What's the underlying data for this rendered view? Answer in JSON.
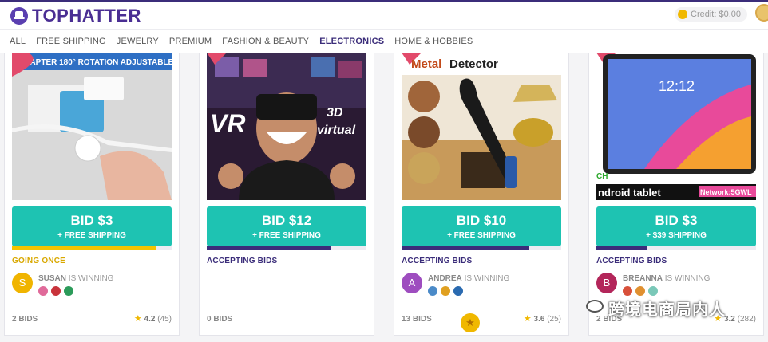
{
  "header": {
    "logo_text": "TOPHATTER",
    "credit": "Credit: $0.00"
  },
  "nav": [
    "ALL",
    "FREE SHIPPING",
    "JEWELRY",
    "PREMIUM",
    "FASHION & BEAUTY",
    "ELECTRONICS",
    "HOME & HOBBIES"
  ],
  "nav_active": "ELECTRONICS",
  "cards": [
    {
      "image_text": "ADAPTER 180° ROTATION ADJUSTABLE",
      "bid": "BID $3",
      "shipping": "+ FREE SHIPPING",
      "progress": 0.9,
      "progress_color": "#f4c400",
      "status": "GOING ONCE",
      "status_color": "#d9a800",
      "winner_initial": "S",
      "winner_name": "SUSAN",
      "winner_suffix": "IS WINNING",
      "avatar_color": "#f0b400",
      "bids": "2 BIDS",
      "rating": "4.2",
      "reviews": "(45)"
    },
    {
      "image_text": "VR 3D virtual",
      "bid": "BID $12",
      "shipping": "+ FREE SHIPPING",
      "progress": 0.78,
      "progress_color": "#3b2d7a",
      "status": "ACCEPTING BIDS",
      "status_color": "#3b2d7a",
      "winner_initial": "",
      "winner_name": "",
      "winner_suffix": "",
      "avatar_color": "",
      "bids": "0 BIDS",
      "rating": "",
      "reviews": ""
    },
    {
      "image_text": "Metal Detector",
      "bid": "BID $10",
      "shipping": "+ FREE SHIPPING",
      "progress": 0.8,
      "progress_color": "#3b2d7a",
      "status": "ACCEPTING BIDS",
      "status_color": "#3b2d7a",
      "winner_initial": "A",
      "winner_name": "ANDREA",
      "winner_suffix": "IS WINNING",
      "avatar_color": "#9e4dbf",
      "bids": "13 BIDS",
      "rating": "3.6",
      "reviews": "(25)"
    },
    {
      "image_text": "ndroid tablet",
      "image_badge": "Network:5GWL",
      "image_time": "12:12",
      "image_corner": "CH",
      "bid": "BID $3",
      "shipping": "+ $39 SHIPPING",
      "progress": 0.32,
      "progress_color": "#3b2d7a",
      "status": "ACCEPTING BIDS",
      "status_color": "#3b2d7a",
      "winner_initial": "B",
      "winner_name": "BREANNA",
      "winner_suffix": "IS WINNING",
      "avatar_color": "#b3265a",
      "bids": "2 BIDS",
      "rating": "3.2",
      "reviews": "(282)"
    }
  ],
  "watermark": "跨境电商局内人",
  "colors": {
    "brand": "#4a2e93",
    "teal": "#1ec3b2",
    "gold": "#f0b800"
  }
}
